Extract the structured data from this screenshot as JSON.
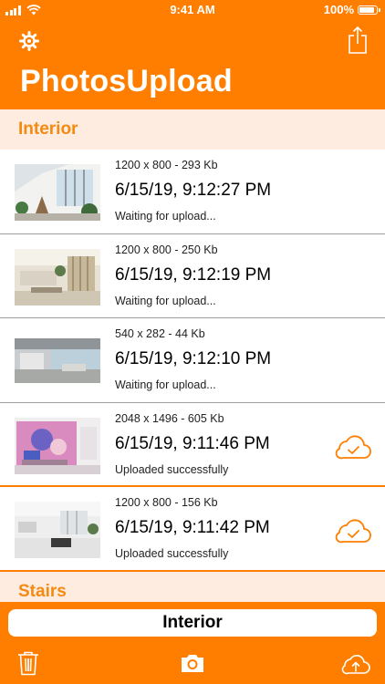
{
  "status_bar": {
    "time": "9:41 AM",
    "battery": "100%",
    "battery_level": 1.0
  },
  "header": {
    "title": "PhotosUpload",
    "left_icon": "gear-icon",
    "right_icon": "share-icon"
  },
  "sections": [
    {
      "title": "Interior"
    },
    {
      "title": "Stairs"
    }
  ],
  "photos": [
    {
      "meta": "1200 x 800 - 293 Kb",
      "date": "6/15/19, 9:12:27 PM",
      "status": "Waiting for upload...",
      "uploaded": false
    },
    {
      "meta": "1200 x 800 - 250 Kb",
      "date": "6/15/19, 9:12:19 PM",
      "status": "Waiting for upload...",
      "uploaded": false
    },
    {
      "meta": "540 x 282 - 44 Kb",
      "date": "6/15/19, 9:12:10 PM",
      "status": "Waiting for upload...",
      "uploaded": false
    },
    {
      "meta": "2048 x 1496 - 605 Kb",
      "date": "6/15/19, 9:11:46 PM",
      "status": "Uploaded successfully",
      "uploaded": true
    },
    {
      "meta": "1200 x 800 - 156 Kb",
      "date": "6/15/19, 9:11:42 PM",
      "status": "Uploaded successfully",
      "uploaded": true
    }
  ],
  "toolbar": {
    "album_label": "Interior",
    "left_icon": "trash-icon",
    "center_icon": "camera-icon",
    "right_icon": "cloud-upload-icon"
  },
  "colors": {
    "accent": "#ff7e00",
    "section_bg": "#fdecdf",
    "section_text": "#f58a12"
  }
}
